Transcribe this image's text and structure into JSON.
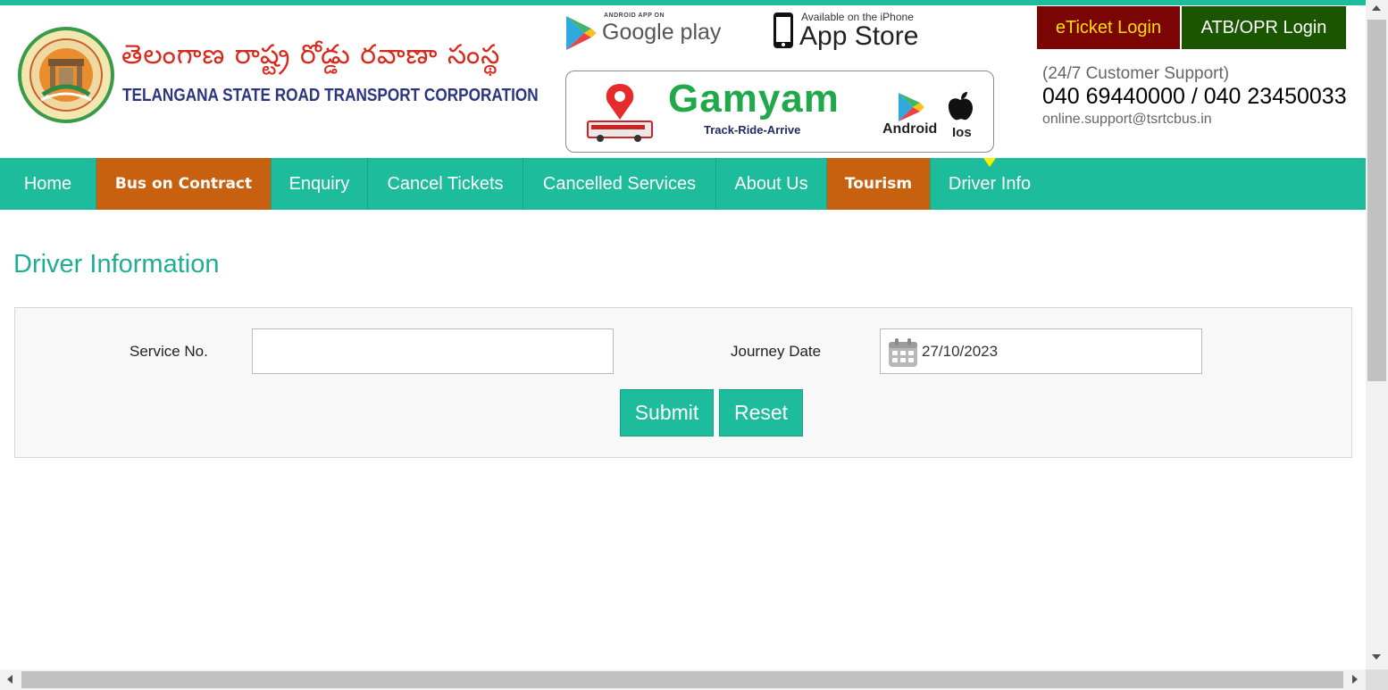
{
  "header": {
    "brand_telugu": "తెలంగాణ  రాష్ట్ర రోడ్డు రవాణా సంస్థ",
    "brand_english": "TELANGANA STATE ROAD TRANSPORT CORPORATION",
    "google_play_small": "ANDROID APP ON",
    "google_play_big": "Google play",
    "app_store_small": "Available on the iPhone",
    "app_store_big": "App Store",
    "gamyam": {
      "title": "Gamyam",
      "tagline": "Track-Ride-Arrive",
      "android": "Android",
      "ios": "Ios"
    },
    "eticket_login": "eTicket Login",
    "atb_login": "ATB/OPR Login",
    "support_label": "(24/7 Customer Support)",
    "support_phone": "040 69440000 / 040 23450033",
    "support_email": "online.support@tsrtcbus.in"
  },
  "nav": {
    "items": [
      {
        "label": "Home"
      },
      {
        "label": "Bus on Contract"
      },
      {
        "label": "Enquiry"
      },
      {
        "label": "Cancel Tickets"
      },
      {
        "label": "Cancelled Services"
      },
      {
        "label": "About Us"
      },
      {
        "label": "Tourism"
      },
      {
        "label": "Driver Info"
      }
    ]
  },
  "main": {
    "title": "Driver Information",
    "service_label": "Service No.",
    "service_value": "",
    "date_label": "Journey Date",
    "date_value": "27/10/2023",
    "submit_label": "Submit",
    "reset_label": "Reset"
  },
  "colors": {
    "accent": "#1dbc9c",
    "nav_orange": "#c8610f",
    "eticket_bg": "#7a0503",
    "eticket_text": "#ffdf00",
    "atb_bg": "#1a5500",
    "title_green": "#1fae94"
  },
  "icons": [
    "emblem-logo",
    "google-play-icon",
    "apple-phone-icon",
    "map-pin-icon",
    "bus-icon",
    "play-store-icon",
    "apple-icon",
    "calendar-icon"
  ]
}
